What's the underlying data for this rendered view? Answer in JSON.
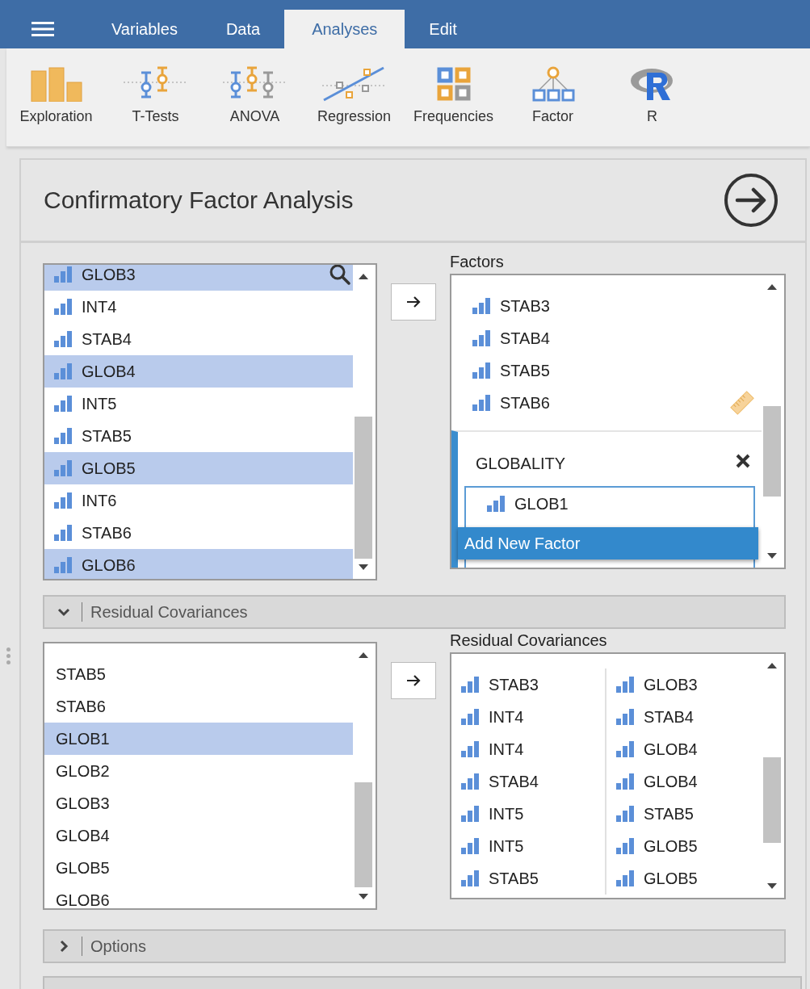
{
  "menu": {
    "tabs": [
      {
        "label": "Variables",
        "selected": false
      },
      {
        "label": "Data",
        "selected": false
      },
      {
        "label": "Analyses",
        "selected": true
      },
      {
        "label": "Edit",
        "selected": false
      }
    ]
  },
  "ribbon": [
    {
      "kind": "exploration",
      "label": "Exploration"
    },
    {
      "kind": "ttests",
      "label": "T-Tests"
    },
    {
      "kind": "anova",
      "label": "ANOVA"
    },
    {
      "kind": "regression",
      "label": "Regression"
    },
    {
      "kind": "frequencies",
      "label": "Frequencies"
    },
    {
      "kind": "factor",
      "label": "Factor"
    },
    {
      "kind": "r",
      "label": "R"
    }
  ],
  "analysis": {
    "title": "Confirmatory Factor Analysis",
    "variables": [
      {
        "name": "GLOB3",
        "selected": true
      },
      {
        "name": "INT4",
        "selected": false
      },
      {
        "name": "STAB4",
        "selected": false
      },
      {
        "name": "GLOB4",
        "selected": true
      },
      {
        "name": "INT5",
        "selected": false
      },
      {
        "name": "STAB5",
        "selected": false
      },
      {
        "name": "GLOB5",
        "selected": true
      },
      {
        "name": "INT6",
        "selected": false
      },
      {
        "name": "STAB6",
        "selected": false
      },
      {
        "name": "GLOB6",
        "selected": true
      }
    ],
    "factors": {
      "label": "Factors",
      "items": [
        {
          "name": "STAB3",
          "hovered": false
        },
        {
          "name": "STAB4",
          "hovered": false
        },
        {
          "name": "STAB5",
          "hovered": false
        },
        {
          "name": "STAB6",
          "hovered": true
        }
      ],
      "factor": {
        "name": "GLOBALITY",
        "items": [
          {
            "name": "GLOB1"
          }
        ]
      },
      "add_button": "Add New Factor"
    },
    "sections": [
      {
        "label": "Residual Covariances",
        "expanded": true
      }
    ],
    "residual_variables": [
      {
        "name": "STAB5",
        "selected": false
      },
      {
        "name": "STAB6",
        "selected": false
      },
      {
        "name": "GLOB1",
        "selected": true
      },
      {
        "name": "GLOB2",
        "selected": false
      },
      {
        "name": "GLOB3",
        "selected": false
      },
      {
        "name": "GLOB4",
        "selected": false
      },
      {
        "name": "GLOB5",
        "selected": false
      },
      {
        "name": "GLOB6",
        "selected": false
      }
    ],
    "residual_covariances": {
      "label": "Residual Covariances",
      "pairs": [
        [
          "STAB3",
          "GLOB3"
        ],
        [
          "INT4",
          "STAB4"
        ],
        [
          "INT4",
          "GLOB4"
        ],
        [
          "STAB4",
          "GLOB4"
        ],
        [
          "INT5",
          "STAB5"
        ],
        [
          "INT5",
          "GLOB5"
        ],
        [
          "STAB5",
          "GLOB5"
        ]
      ]
    },
    "more_sections": [
      {
        "label": "Options",
        "expanded": false
      }
    ]
  }
}
